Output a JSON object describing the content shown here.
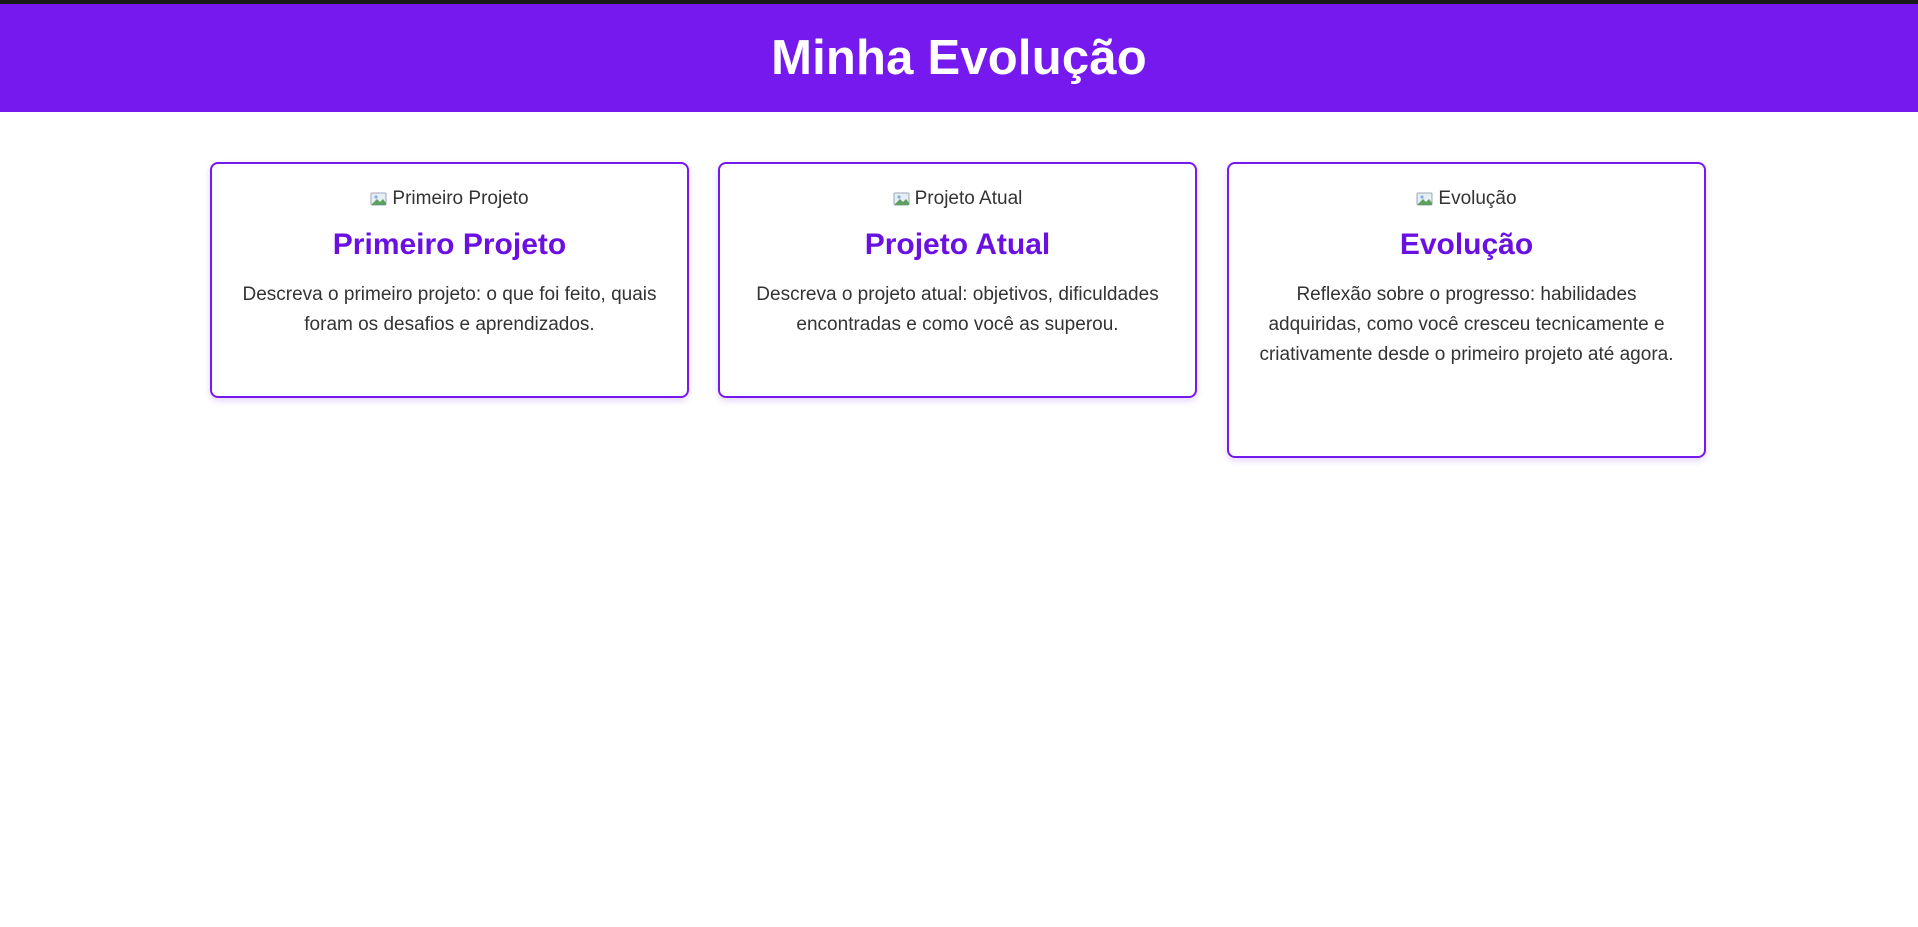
{
  "header": {
    "title": "Minha Evolução"
  },
  "cards": [
    {
      "image_alt": "Primeiro Projeto",
      "title": "Primeiro Projeto",
      "description": "Descreva o primeiro projeto: o que foi feito, quais foram os desafios e aprendizados."
    },
    {
      "image_alt": "Projeto Atual",
      "title": "Projeto Atual",
      "description": "Descreva o projeto atual: objetivos, dificuldades encontradas e como você as superou."
    },
    {
      "image_alt": "Evolução",
      "title": "Evolução",
      "description": "Reflexão sobre o progresso: habilidades adquiridas, como você cresceu tecnicamente e criativamente desde o primeiro projeto até agora."
    }
  ],
  "colors": {
    "header_bg": "#7519ef",
    "accent_title": "#6a10e0",
    "card_border": "#7519ef",
    "body_text": "#333333"
  },
  "icons": {
    "image_placeholder": "broken-image-icon"
  }
}
